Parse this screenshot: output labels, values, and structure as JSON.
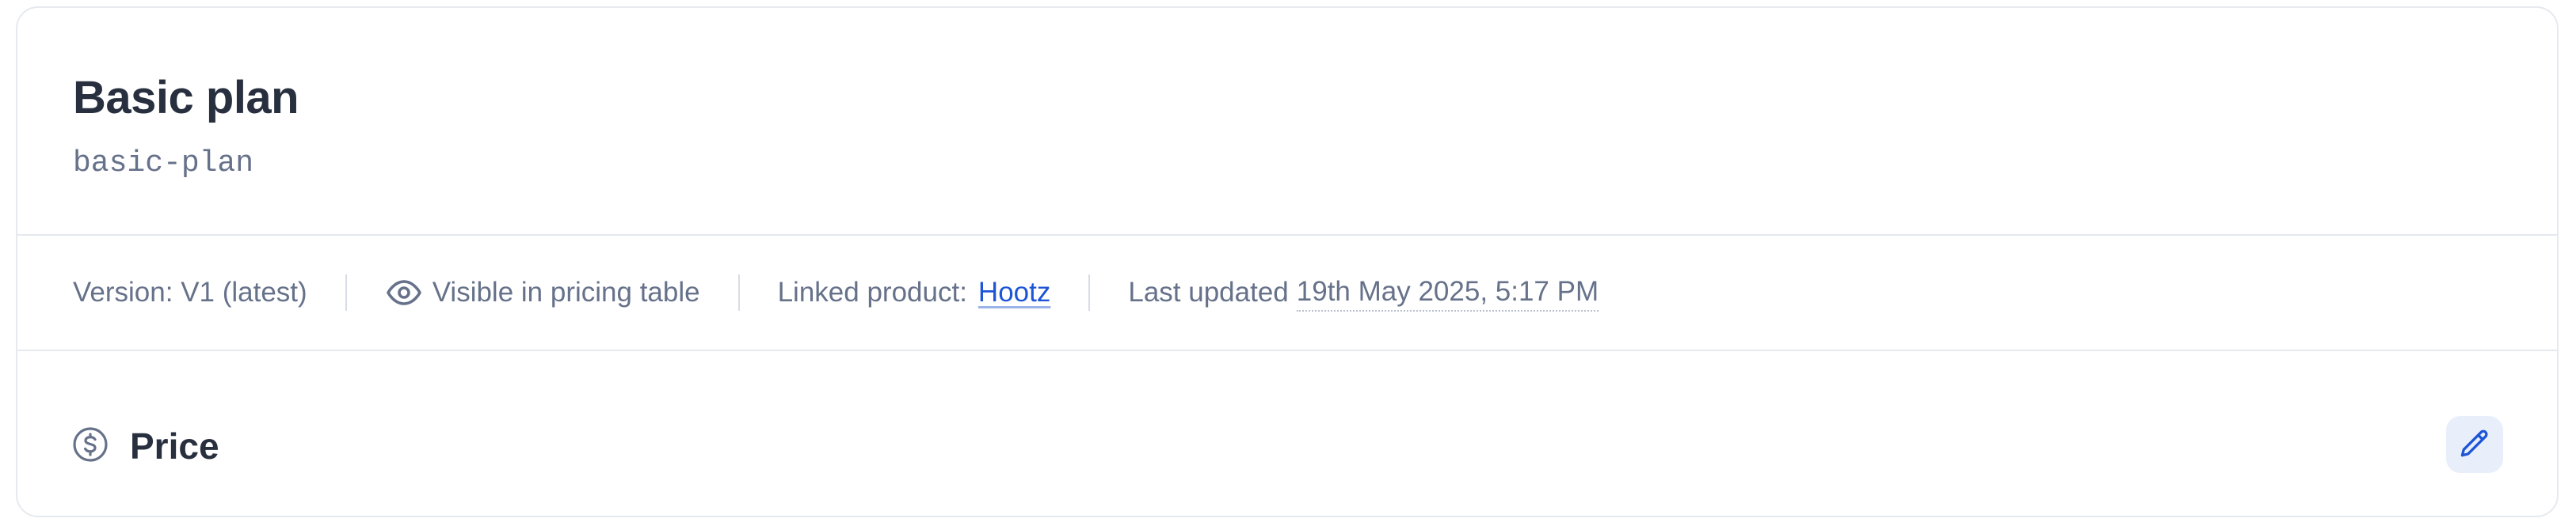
{
  "plan": {
    "title": "Basic plan",
    "slug": "basic-plan"
  },
  "meta": {
    "version": "Version: V1 (latest)",
    "visibility": "Visible in pricing table",
    "visibility_icon": "eye-icon",
    "linked_product_label": "Linked product:",
    "linked_product": "Hootz",
    "last_updated_label": "Last updated",
    "last_updated_value": "19th May 2025, 5:17 PM"
  },
  "price_section": {
    "icon": "dollar-circle-icon",
    "label": "Price",
    "edit_icon": "pencil-icon"
  },
  "colors": {
    "text_primary": "#28303f",
    "text_muted": "#66718a",
    "link": "#1d55d6",
    "edit_bg": "#e8effb",
    "border": "#e6e9ee"
  }
}
